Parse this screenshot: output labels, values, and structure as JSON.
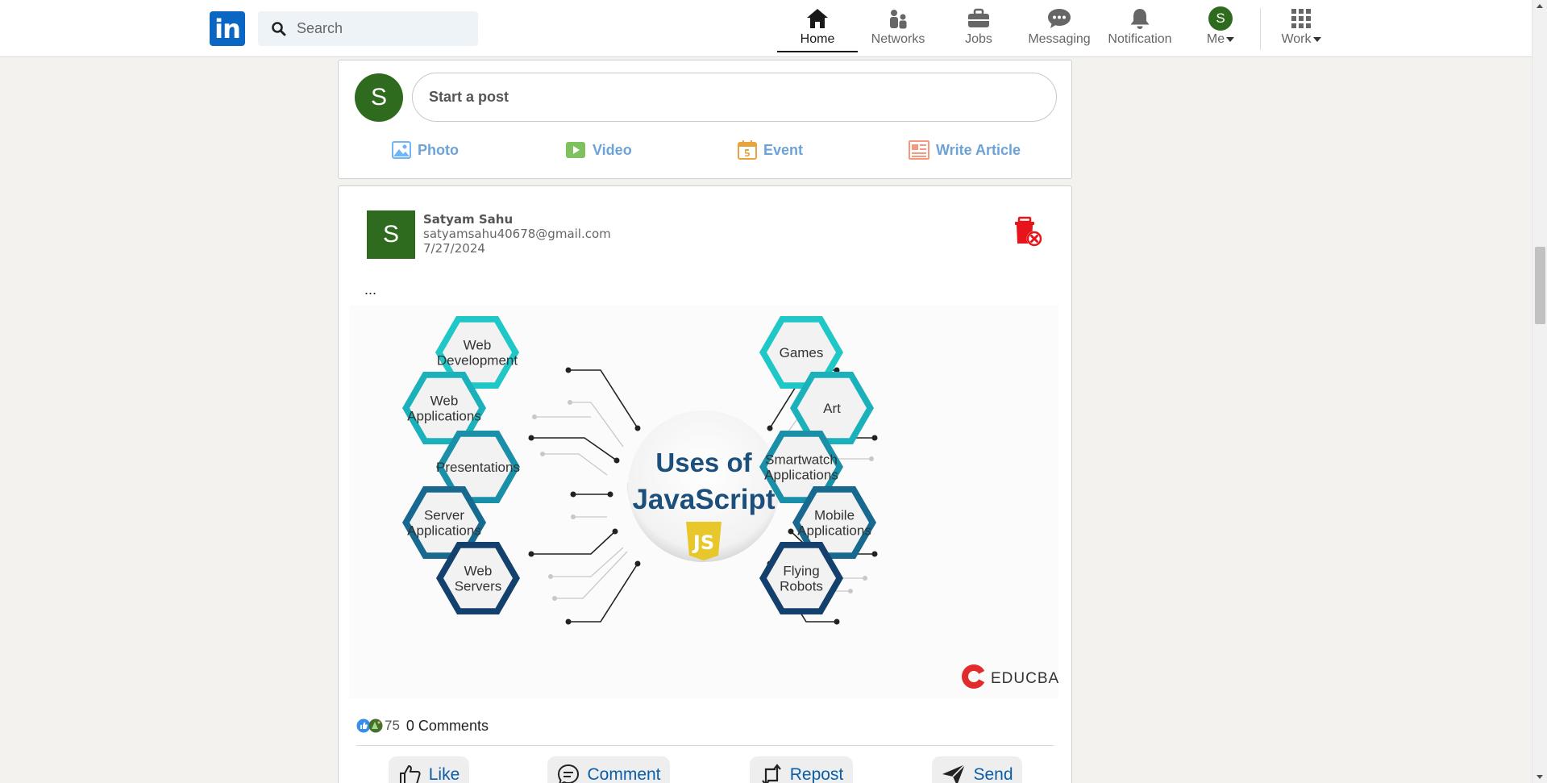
{
  "nav": {
    "logo_text": "in",
    "search_placeholder": "Search",
    "items": [
      {
        "label": "Home",
        "icon": "home-icon",
        "active": true
      },
      {
        "label": "Networks",
        "icon": "network-icon"
      },
      {
        "label": "Jobs",
        "icon": "briefcase-icon"
      },
      {
        "label": "Messaging",
        "icon": "messaging-icon"
      },
      {
        "label": "Notification",
        "icon": "bell-icon"
      },
      {
        "label": "Me",
        "icon": "avatar",
        "avatar_letter": "S"
      },
      {
        "label": "Work",
        "icon": "grid-icon"
      }
    ]
  },
  "composer": {
    "avatar_letter": "S",
    "placeholder_button": "Start a post",
    "actions": [
      {
        "label": "Photo",
        "icon": "photo-icon",
        "color": "#70b5f9"
      },
      {
        "label": "Video",
        "icon": "video-icon",
        "color": "#7fc15e"
      },
      {
        "label": "Event",
        "icon": "calendar-icon",
        "color": "#e7a33e"
      },
      {
        "label": "Write Article",
        "icon": "article-icon",
        "color": "#f5987e"
      }
    ]
  },
  "post": {
    "avatar_letter": "S",
    "author": "Satyam Sahu",
    "email": "satyamsahu40678@gmail.com",
    "date": "7/27/2024",
    "text": "...",
    "image": {
      "title_line1": "Uses of",
      "title_line2": "JavaScript",
      "badge": "JS",
      "brand": "EDUCBA",
      "left_hexes": [
        [
          "Web",
          "Development"
        ],
        [
          "Web",
          "Applications"
        ],
        [
          "Presentations"
        ],
        [
          "Server",
          "Applications"
        ],
        [
          "Web",
          "Servers"
        ]
      ],
      "right_hexes": [
        [
          "Games"
        ],
        [
          "Art"
        ],
        [
          "Smartwatch",
          "Applications"
        ],
        [
          "Mobile",
          "Applications"
        ],
        [
          "Flying",
          "Robots"
        ]
      ]
    },
    "reaction_count": "75",
    "comments": "0 Comments",
    "buttons": {
      "like": "Like",
      "comment": "Comment",
      "repost": "Repost",
      "send": "Send"
    }
  },
  "colors": {
    "linkedin_blue": "#0a66c2",
    "avatar_green": "#2e6b1f",
    "delete_red": "#e8141c"
  }
}
